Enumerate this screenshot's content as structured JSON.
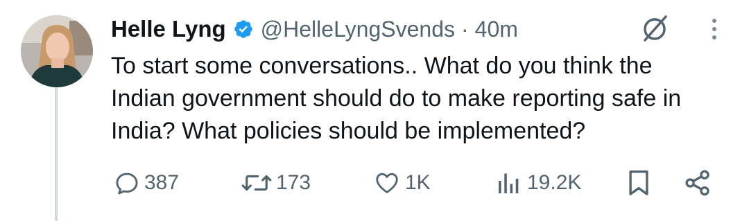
{
  "tweet": {
    "author_name": "Helle Lyng",
    "handle": "@HelleLyngSvends",
    "separator": "·",
    "time": "40m",
    "text": "To start some conversations.. What do you think the Indian government should do to make reporting safe in India? What policies should be implemented?",
    "verified": true
  },
  "actions": {
    "replies": "387",
    "reposts": "173",
    "likes": "1K",
    "views": "19.2K"
  },
  "colors": {
    "text": "#0f1419",
    "secondary": "#536471",
    "verified_blue": "#1d9bf0",
    "thread_line": "#cfd9de"
  },
  "icons": [
    "verified-badge-icon",
    "grok-icon",
    "more-icon",
    "reply-icon",
    "repost-icon",
    "like-icon",
    "views-icon",
    "bookmark-icon",
    "share-icon"
  ]
}
